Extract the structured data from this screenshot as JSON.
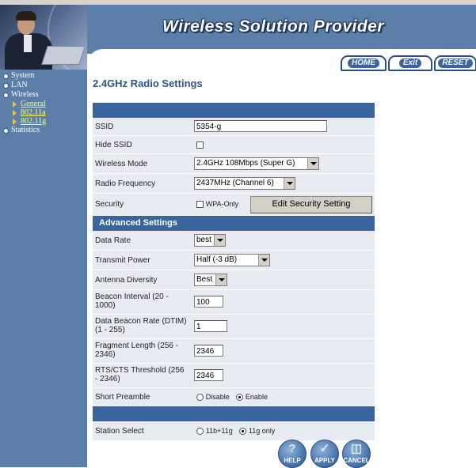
{
  "header": {
    "brand": "Wireless Solution Provider"
  },
  "top_tabs": [
    {
      "label": "HOME"
    },
    {
      "label": "Exit"
    },
    {
      "label": "RESET"
    }
  ],
  "sidebar": {
    "items": [
      {
        "label": "System"
      },
      {
        "label": "LAN"
      },
      {
        "label": "Wireless"
      },
      {
        "label": "General"
      },
      {
        "label": "802.11a"
      },
      {
        "label": "802.11g"
      },
      {
        "label": "Statistics"
      }
    ]
  },
  "page": {
    "title": "2.4GHz Radio Settings"
  },
  "form": {
    "ssid": {
      "label": "SSID",
      "value": "5354-g"
    },
    "hide_ssid": {
      "label": "Hide SSID",
      "checked": false
    },
    "wireless_mode": {
      "label": "Wireless Mode",
      "value": "2.4GHz 108Mbps (Super G)"
    },
    "radio_frequency": {
      "label": "Radio Frequency",
      "value": "2437MHz (Channel 6)"
    },
    "security": {
      "label": "Security",
      "wpa_only_label": "WPA-Only",
      "wpa_only_checked": false,
      "button_label": "Edit Security Setting"
    }
  },
  "advanced": {
    "title": "Advanced Settings",
    "data_rate": {
      "label": "Data Rate",
      "value": "best"
    },
    "transmit_power": {
      "label": "Transmit Power",
      "value": "Half (-3 dB)"
    },
    "antenna_diversity": {
      "label": "Antenna Diversity",
      "value": "Best"
    },
    "beacon_interval": {
      "label_line1": "Beacon Interval (20 -",
      "label_line2": "1000)",
      "value": "100"
    },
    "dtim": {
      "label_line1": "Data Beacon Rate (DTIM)",
      "label_line2": "(1 - 255)",
      "value": "1"
    },
    "fragment_length": {
      "label_line1": "Fragment Length (256 -",
      "label_line2": "2346)",
      "value": "2346"
    },
    "rts_threshold": {
      "label_line1": "RTS/CTS Threshold (256",
      "label_line2": "- 2346)",
      "value": "2346"
    },
    "short_preamble": {
      "label": "Short Preamble",
      "options": [
        "Disable",
        "Enable"
      ],
      "selected": "Enable"
    }
  },
  "station_select": {
    "label": "Station Select",
    "options": [
      "11b+11g",
      "11g only"
    ],
    "selected": "11g only"
  },
  "actions": [
    {
      "label": "HELP",
      "icon": "question-icon"
    },
    {
      "label": "APPLY",
      "icon": "check-icon"
    },
    {
      "label": "CANCEL",
      "icon": "trash-icon"
    }
  ]
}
